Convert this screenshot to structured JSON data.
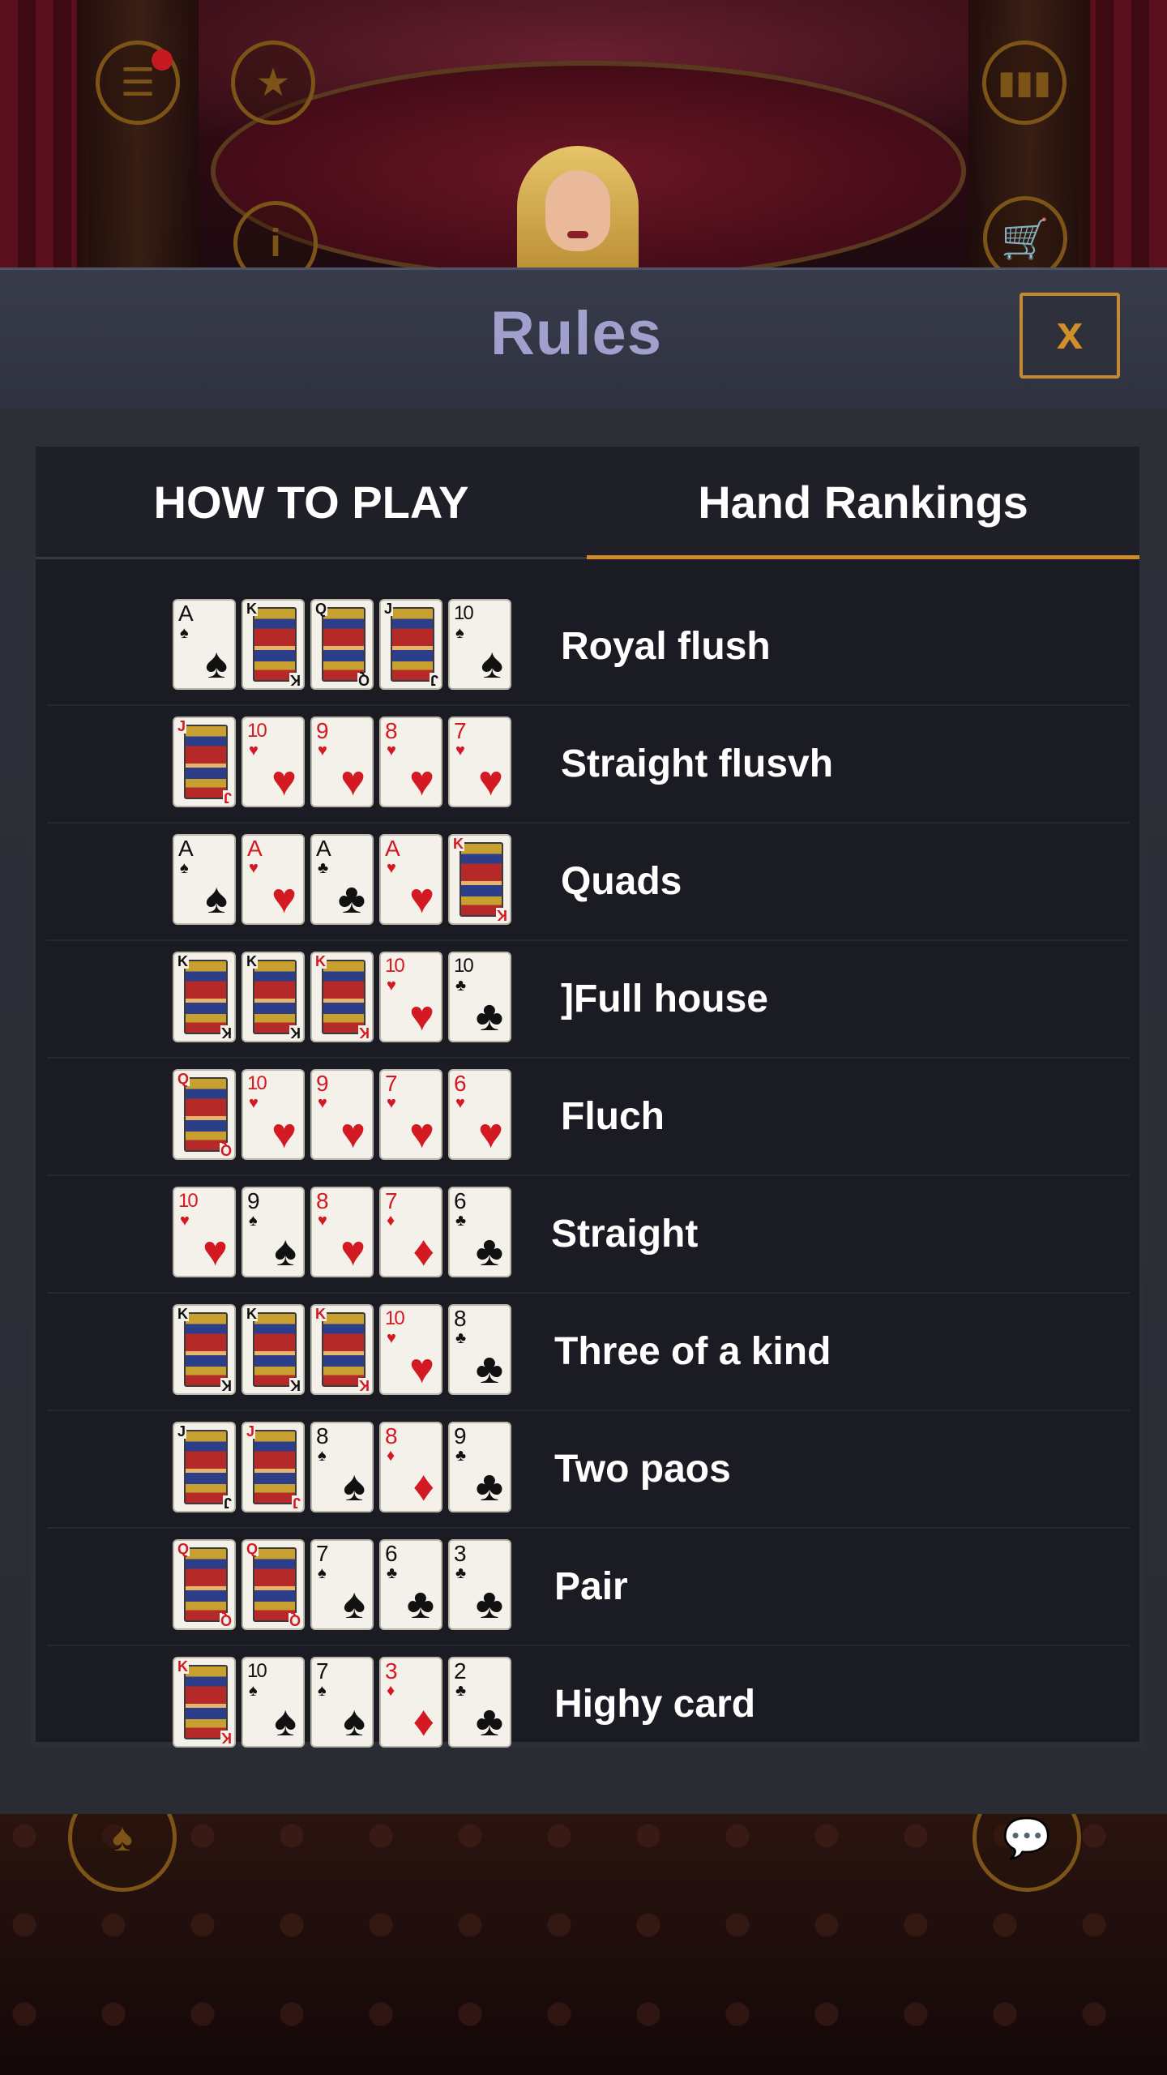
{
  "modal": {
    "title": "Rules",
    "close_label": "x"
  },
  "tabs": [
    {
      "label": "HOW TO PLAY",
      "active": false
    },
    {
      "label": "Hand Rankings",
      "active": true
    }
  ],
  "colors": {
    "accent": "#d08a2a",
    "title": "#a19fcb",
    "red_suit": "#d31a22",
    "black_suit": "#111111"
  },
  "hands": [
    {
      "name": "Royal flush",
      "cards": [
        [
          "A",
          "♠"
        ],
        [
          "K",
          "♠"
        ],
        [
          "Q",
          "♠"
        ],
        [
          "J",
          "♠"
        ],
        [
          "10",
          "♠"
        ]
      ]
    },
    {
      "name": "Straight flusvh",
      "cards": [
        [
          "J",
          "♥"
        ],
        [
          "10",
          "♥"
        ],
        [
          "9",
          "♥"
        ],
        [
          "8",
          "♥"
        ],
        [
          "7",
          "♥"
        ]
      ]
    },
    {
      "name": "Quads",
      "cards": [
        [
          "A",
          "♠"
        ],
        [
          "A",
          "♥"
        ],
        [
          "A",
          "♣"
        ],
        [
          "A",
          "♥"
        ],
        [
          "K",
          "♥"
        ]
      ]
    },
    {
      "name": "]Full house",
      "cards": [
        [
          "K",
          "♠"
        ],
        [
          "K",
          "♠"
        ],
        [
          "K",
          "♥"
        ],
        [
          "10",
          "♥"
        ],
        [
          "10",
          "♣"
        ]
      ]
    },
    {
      "name": "Fluch",
      "cards": [
        [
          "Q",
          "♥"
        ],
        [
          "10",
          "♥"
        ],
        [
          "9",
          "♥"
        ],
        [
          "7",
          "♥"
        ],
        [
          "6",
          "♥"
        ]
      ]
    },
    {
      "name": "Straight",
      "cards": [
        [
          "10",
          "♥"
        ],
        [
          "9",
          "♠"
        ],
        [
          "8",
          "♥"
        ],
        [
          "7",
          "♦"
        ],
        [
          "6",
          "♣"
        ]
      ]
    },
    {
      "name": "Three of a kind",
      "cards": [
        [
          "K",
          "♠"
        ],
        [
          "K",
          "♠"
        ],
        [
          "K",
          "♥"
        ],
        [
          "10",
          "♥"
        ],
        [
          "8",
          "♣"
        ]
      ]
    },
    {
      "name": "Two paos",
      "cards": [
        [
          "J",
          "♠"
        ],
        [
          "J",
          "♥"
        ],
        [
          "8",
          "♠"
        ],
        [
          "8",
          "♦"
        ],
        [
          "9",
          "♣"
        ]
      ]
    },
    {
      "name": "Pair",
      "cards": [
        [
          "Q",
          "♥"
        ],
        [
          "Q",
          "♥"
        ],
        [
          "7",
          "♠"
        ],
        [
          "6",
          "♣"
        ],
        [
          "3",
          "♣"
        ]
      ]
    },
    {
      "name": "Highy card",
      "cards": [
        [
          "K",
          "♥"
        ],
        [
          "10",
          "♠"
        ],
        [
          "7",
          "♠"
        ],
        [
          "3",
          "♦"
        ],
        [
          "2",
          "♣"
        ]
      ]
    }
  ],
  "background_icons": [
    "menu-icon",
    "bookmark-star-icon",
    "info-icon",
    "stats-icon",
    "cart-icon",
    "cards-icon",
    "chat-icon"
  ]
}
